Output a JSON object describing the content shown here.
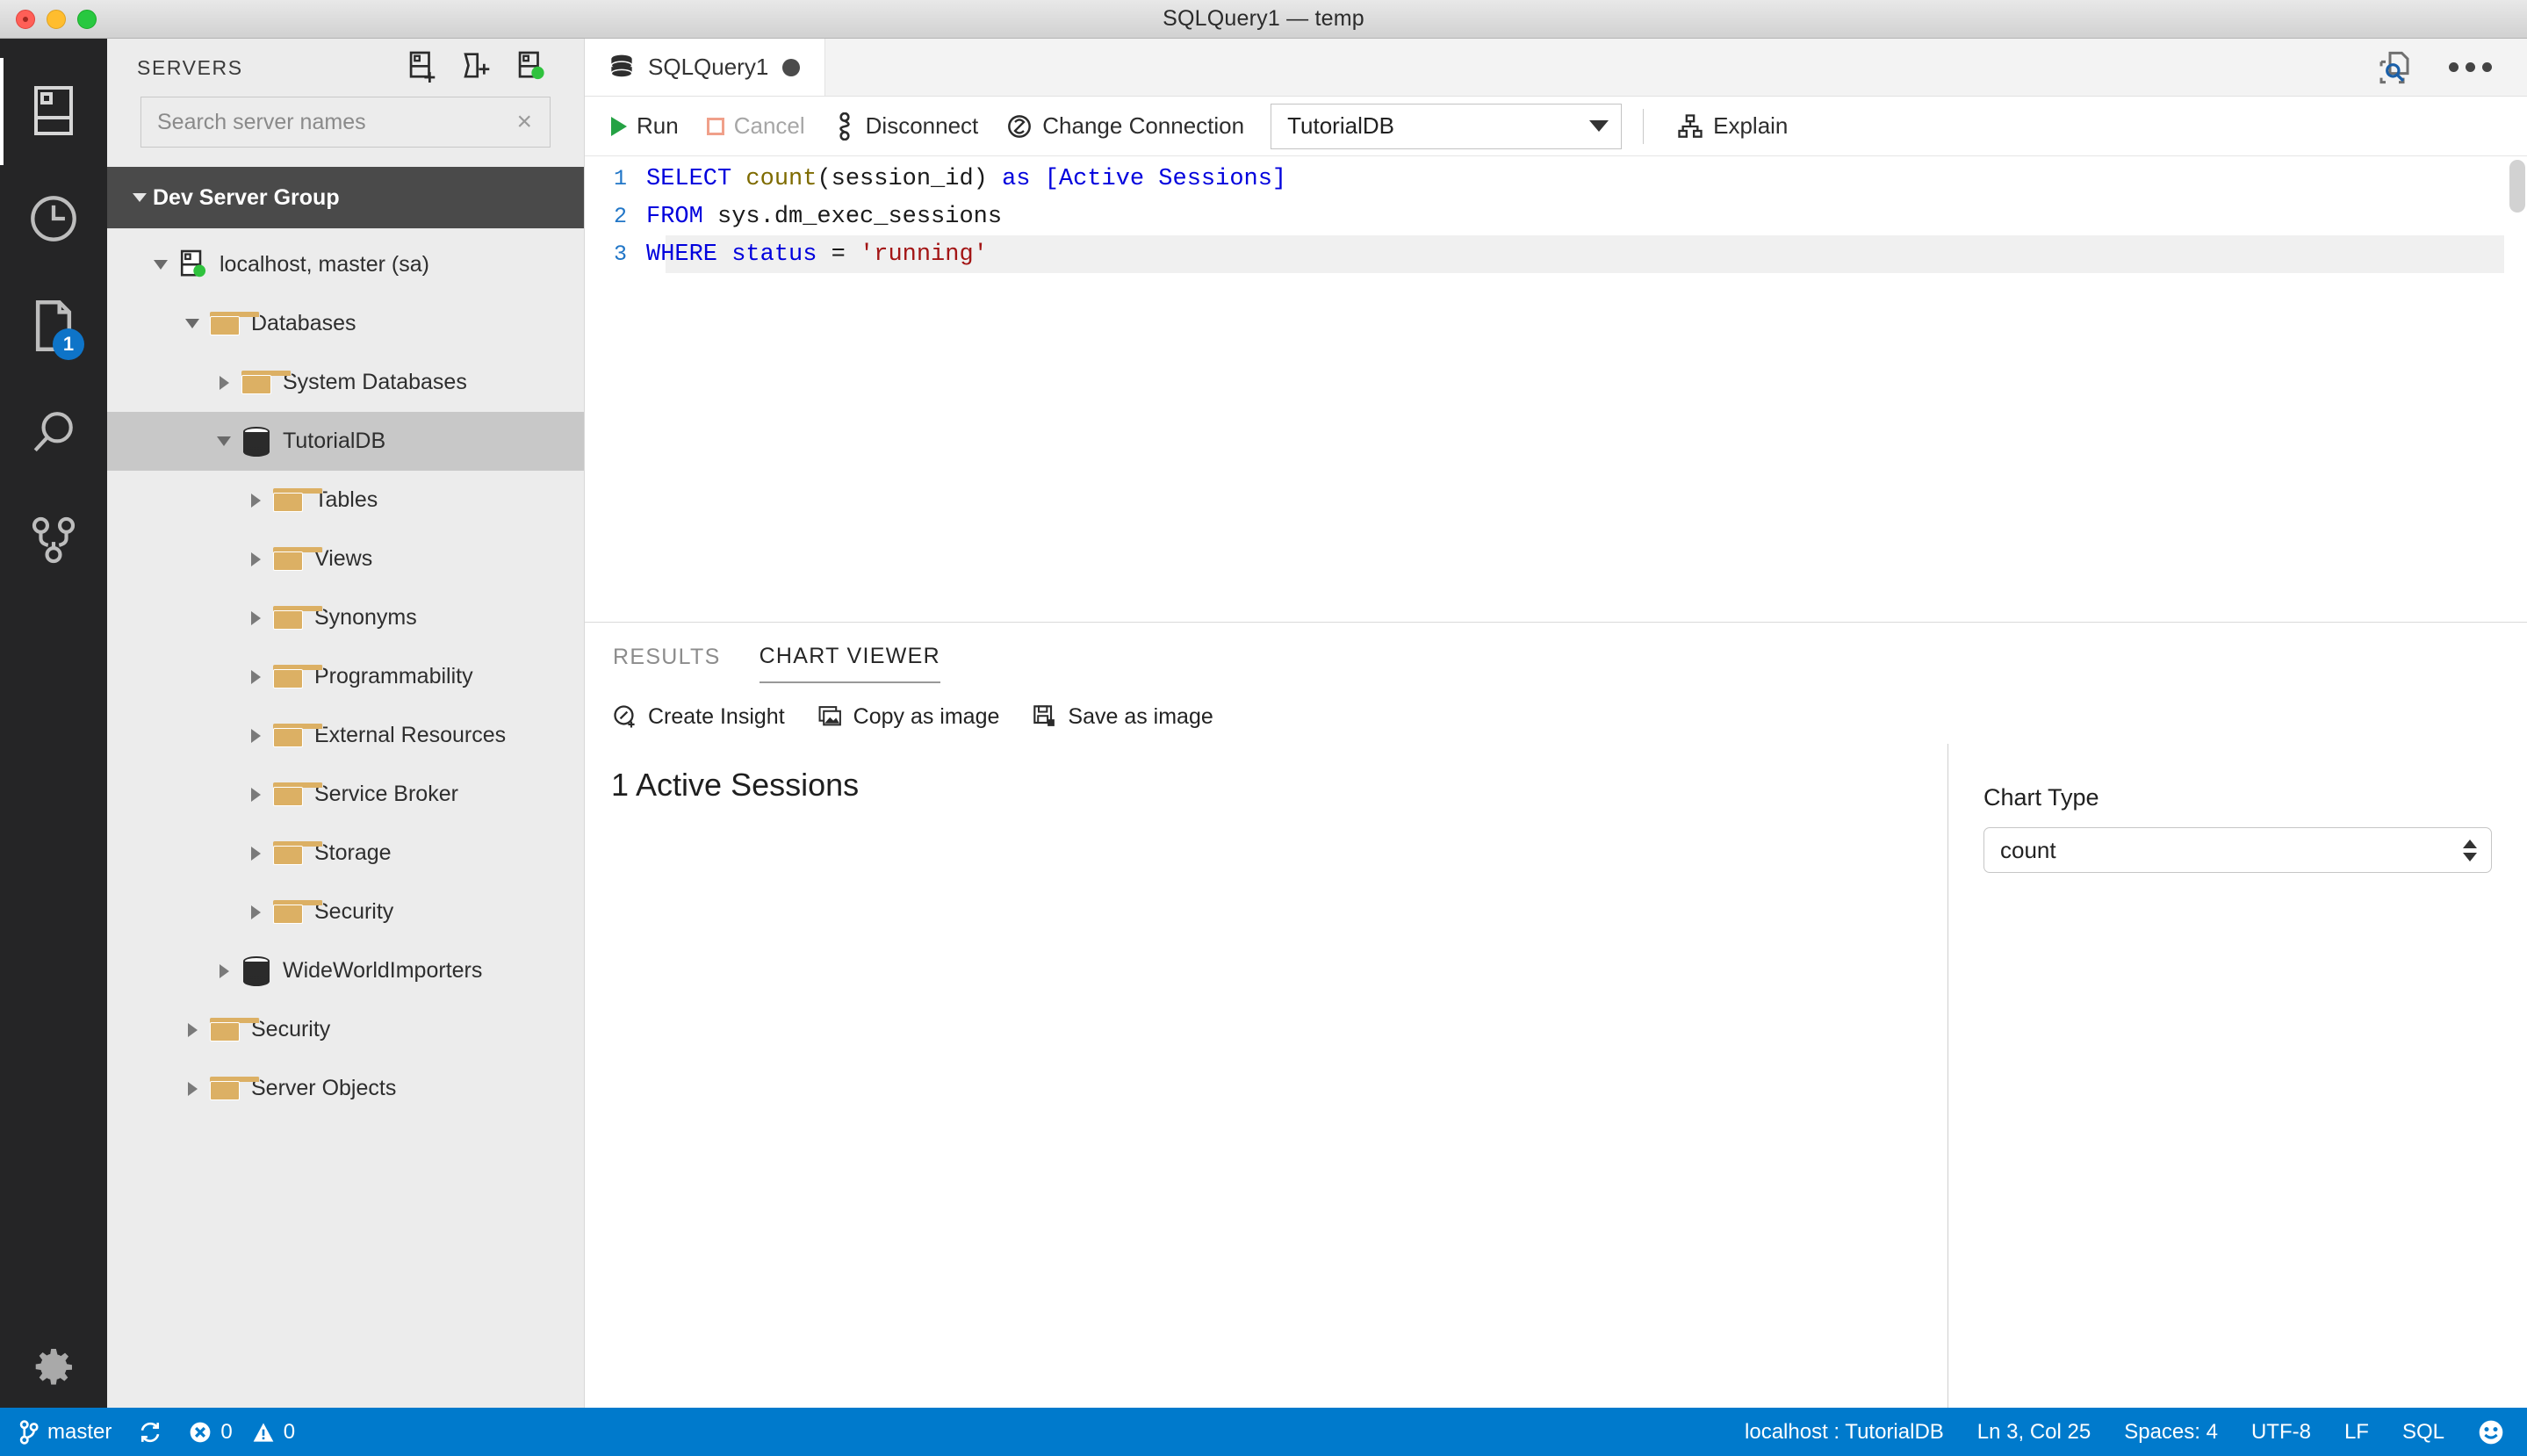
{
  "window": {
    "title": "SQLQuery1 — temp",
    "traffic_lights": [
      "close",
      "minimize",
      "zoom"
    ]
  },
  "activity_bar": {
    "items": [
      {
        "name": "servers",
        "icon": "servers-icon",
        "active": true,
        "badge": ""
      },
      {
        "name": "history",
        "icon": "clock-icon",
        "active": false,
        "badge": ""
      },
      {
        "name": "query-history-files",
        "icon": "file-icon",
        "active": false,
        "badge": "1"
      },
      {
        "name": "search",
        "icon": "search-icon",
        "active": false,
        "badge": ""
      },
      {
        "name": "source-control",
        "icon": "source-control-icon",
        "active": false,
        "badge": ""
      }
    ],
    "settings": {
      "name": "manage",
      "icon": "gear-icon"
    }
  },
  "sidebar": {
    "title": "SERVERS",
    "actions": [
      {
        "name": "new-connection",
        "icon": "add-server-icon"
      },
      {
        "name": "new-server-group",
        "icon": "add-folder-icon"
      },
      {
        "name": "refresh-servers",
        "icon": "connected-server-icon"
      }
    ],
    "search": {
      "placeholder": "Search server names",
      "value": "",
      "clear_label": "×"
    },
    "group": {
      "label": "Dev Server Group",
      "expanded": true
    },
    "tree": [
      {
        "label": "localhost, master (sa)",
        "icon": "server-icon",
        "depth": 1,
        "state": "expanded",
        "selected": false
      },
      {
        "label": "Databases",
        "icon": "folder-icon",
        "depth": 2,
        "state": "expanded",
        "selected": false
      },
      {
        "label": "System Databases",
        "icon": "folder-icon",
        "depth": 3,
        "state": "collapsed",
        "selected": false
      },
      {
        "label": "TutorialDB",
        "icon": "database-icon",
        "depth": 3,
        "state": "expanded",
        "selected": true
      },
      {
        "label": "Tables",
        "icon": "folder-icon",
        "depth": 4,
        "state": "collapsed",
        "selected": false
      },
      {
        "label": "Views",
        "icon": "folder-icon",
        "depth": 4,
        "state": "collapsed",
        "selected": false
      },
      {
        "label": "Synonyms",
        "icon": "folder-icon",
        "depth": 4,
        "state": "collapsed",
        "selected": false
      },
      {
        "label": "Programmability",
        "icon": "folder-icon",
        "depth": 4,
        "state": "collapsed",
        "selected": false
      },
      {
        "label": "External Resources",
        "icon": "folder-icon",
        "depth": 4,
        "state": "collapsed",
        "selected": false
      },
      {
        "label": "Service Broker",
        "icon": "folder-icon",
        "depth": 4,
        "state": "collapsed",
        "selected": false
      },
      {
        "label": "Storage",
        "icon": "folder-icon",
        "depth": 4,
        "state": "collapsed",
        "selected": false
      },
      {
        "label": "Security",
        "icon": "folder-icon",
        "depth": 4,
        "state": "collapsed",
        "selected": false
      },
      {
        "label": "WideWorldImporters",
        "icon": "database-icon",
        "depth": 3,
        "state": "collapsed",
        "selected": false
      },
      {
        "label": "Security",
        "icon": "folder-icon",
        "depth": 2,
        "state": "collapsed",
        "selected": false
      },
      {
        "label": "Server Objects",
        "icon": "folder-icon",
        "depth": 2,
        "state": "collapsed",
        "selected": false
      }
    ]
  },
  "editor": {
    "tab": {
      "label": "SQLQuery1",
      "icon": "database-icon",
      "dirty": true
    },
    "tab_actions": [
      {
        "name": "find-in-files",
        "icon": "search-document-icon"
      },
      {
        "name": "more-actions",
        "icon": "ellipsis-icon"
      }
    ],
    "toolbar": {
      "run_label": "Run",
      "cancel_label": "Cancel",
      "cancel_disabled": true,
      "disconnect_label": "Disconnect",
      "change_connection_label": "Change Connection",
      "database_selected": "TutorialDB",
      "explain_label": "Explain"
    },
    "lines": [
      {
        "number": "1",
        "tokens": [
          {
            "t": "SELECT ",
            "c": "k-key"
          },
          {
            "t": "count",
            "c": "k-fn"
          },
          {
            "t": "(session_id) ",
            "c": "k-id"
          },
          {
            "t": "as ",
            "c": "k-key"
          },
          {
            "t": "[Active Sessions]",
            "c": "k-br"
          }
        ]
      },
      {
        "number": "2",
        "tokens": [
          {
            "t": "FROM ",
            "c": "k-key"
          },
          {
            "t": "sys.dm_exec_sessions",
            "c": "k-id"
          }
        ]
      },
      {
        "number": "3",
        "tokens": [
          {
            "t": "WHERE status ",
            "c": "k-key"
          },
          {
            "t": "= ",
            "c": "k-id"
          },
          {
            "t": "'running'",
            "c": "k-str"
          }
        ]
      }
    ],
    "plain_text": "SELECT count(session_id) as [Active Sessions]\nFROM sys.dm_exec_sessions\nWHERE status = 'running'"
  },
  "results": {
    "tabs": [
      {
        "label": "RESULTS",
        "active": false
      },
      {
        "label": "CHART VIEWER",
        "active": true
      }
    ],
    "chart_actions": [
      {
        "label": "Create Insight",
        "icon": "create-insight-icon"
      },
      {
        "label": "Copy as image",
        "icon": "copy-image-icon"
      },
      {
        "label": "Save as image",
        "icon": "save-image-icon"
      }
    ],
    "chart_type_label": "Chart Type",
    "chart_type_value": "count"
  },
  "chart_data": {
    "type": "table",
    "title": "",
    "categories": [
      "Active Sessions"
    ],
    "values": [
      1
    ],
    "display_text": "1 Active Sessions",
    "value_label": "1",
    "series_label": "Active Sessions",
    "xlabel": "",
    "ylabel": "",
    "legend": [],
    "grid": false
  },
  "statusbar": {
    "branch": "master",
    "branch_icon": "source-control-icon",
    "sync_icon": "sync-icon",
    "errors": "0",
    "warnings": "0",
    "connection": "localhost : TutorialDB",
    "cursor": "Ln 3, Col 25",
    "spaces": "Spaces: 4",
    "encoding": "UTF-8",
    "eol": "LF",
    "language": "SQL",
    "feedback_icon": "smiley-icon"
  }
}
